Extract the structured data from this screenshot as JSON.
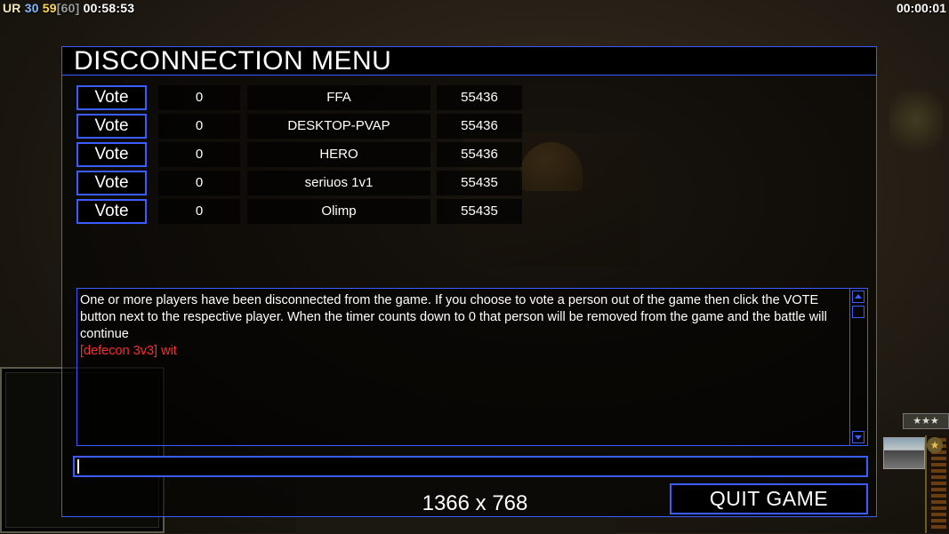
{
  "hud": {
    "faction": "UR",
    "val_a": "30",
    "val_b": "59",
    "val_c": "[60]",
    "game_time": "00:58:53",
    "timer": "00:00:01",
    "rank_stars": "★★★"
  },
  "dialog": {
    "title": "DISCONNECTION MENU",
    "players": [
      {
        "vote_label": "Vote",
        "count": "0",
        "name": "FFA",
        "port": "55436"
      },
      {
        "vote_label": "Vote",
        "count": "0",
        "name": "DESKTOP-PVAP",
        "port": "55436"
      },
      {
        "vote_label": "Vote",
        "count": "0",
        "name": "HERO",
        "port": "55436"
      },
      {
        "vote_label": "Vote",
        "count": "0",
        "name": "seriuos 1v1",
        "port": "55435"
      },
      {
        "vote_label": "Vote",
        "count": "0",
        "name": "Olimp",
        "port": "55435"
      }
    ],
    "message": "One or more players have been disconnected from the game. If you choose to vote a person out of the game then click the VOTE button next to the respective player. When the timer counts down to 0 that person will be removed from the game and the battle will continue",
    "chat_line": "[defecon 3v3] wit",
    "chat_input_value": "",
    "resolution": "1366 x 768",
    "quit_label": "QUIT GAME"
  },
  "colors": {
    "accent": "#3b5cff",
    "chat_red": "#ff2a2a",
    "hud_yellow": "#ffd84a",
    "hud_blue": "#7fb8ff"
  }
}
